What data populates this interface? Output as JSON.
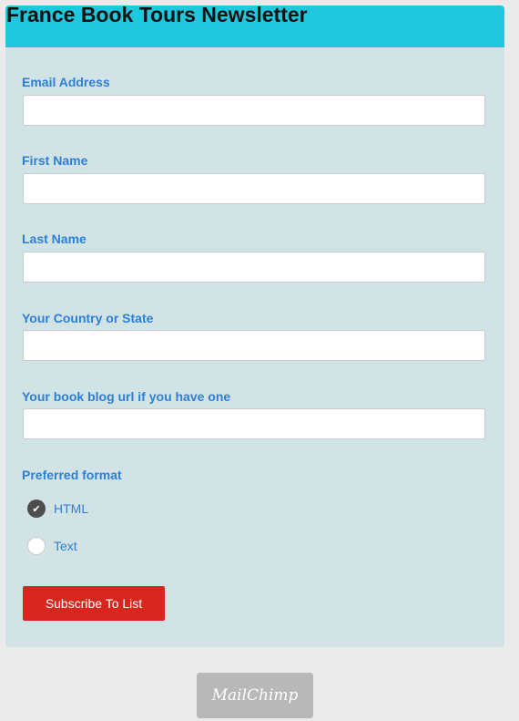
{
  "form": {
    "title": "France Book Tours Newsletter",
    "fields": [
      {
        "label": "Email Address",
        "value": "",
        "placeholder": ""
      },
      {
        "label": "First Name",
        "value": "",
        "placeholder": ""
      },
      {
        "label": "Last Name",
        "value": "",
        "placeholder": ""
      },
      {
        "label": "Your Country or State",
        "value": "",
        "placeholder": ""
      },
      {
        "label": "Your book blog url if you have one",
        "value": "",
        "placeholder": ""
      }
    ],
    "format": {
      "label": "Preferred format",
      "options": [
        {
          "label": "HTML",
          "checked": true
        },
        {
          "label": "Text",
          "checked": false
        }
      ]
    },
    "subscribe_label": "Subscribe To List"
  },
  "footer": {
    "badge_label": "MailChimp"
  },
  "colors": {
    "header": "#1fc8de",
    "card": "#d2e3e5",
    "label": "#2c7fd8",
    "button": "#d8261f",
    "page": "#ebebeb",
    "badge": "#b8b8b8"
  },
  "icons": {
    "checked_radio": "check-icon"
  }
}
